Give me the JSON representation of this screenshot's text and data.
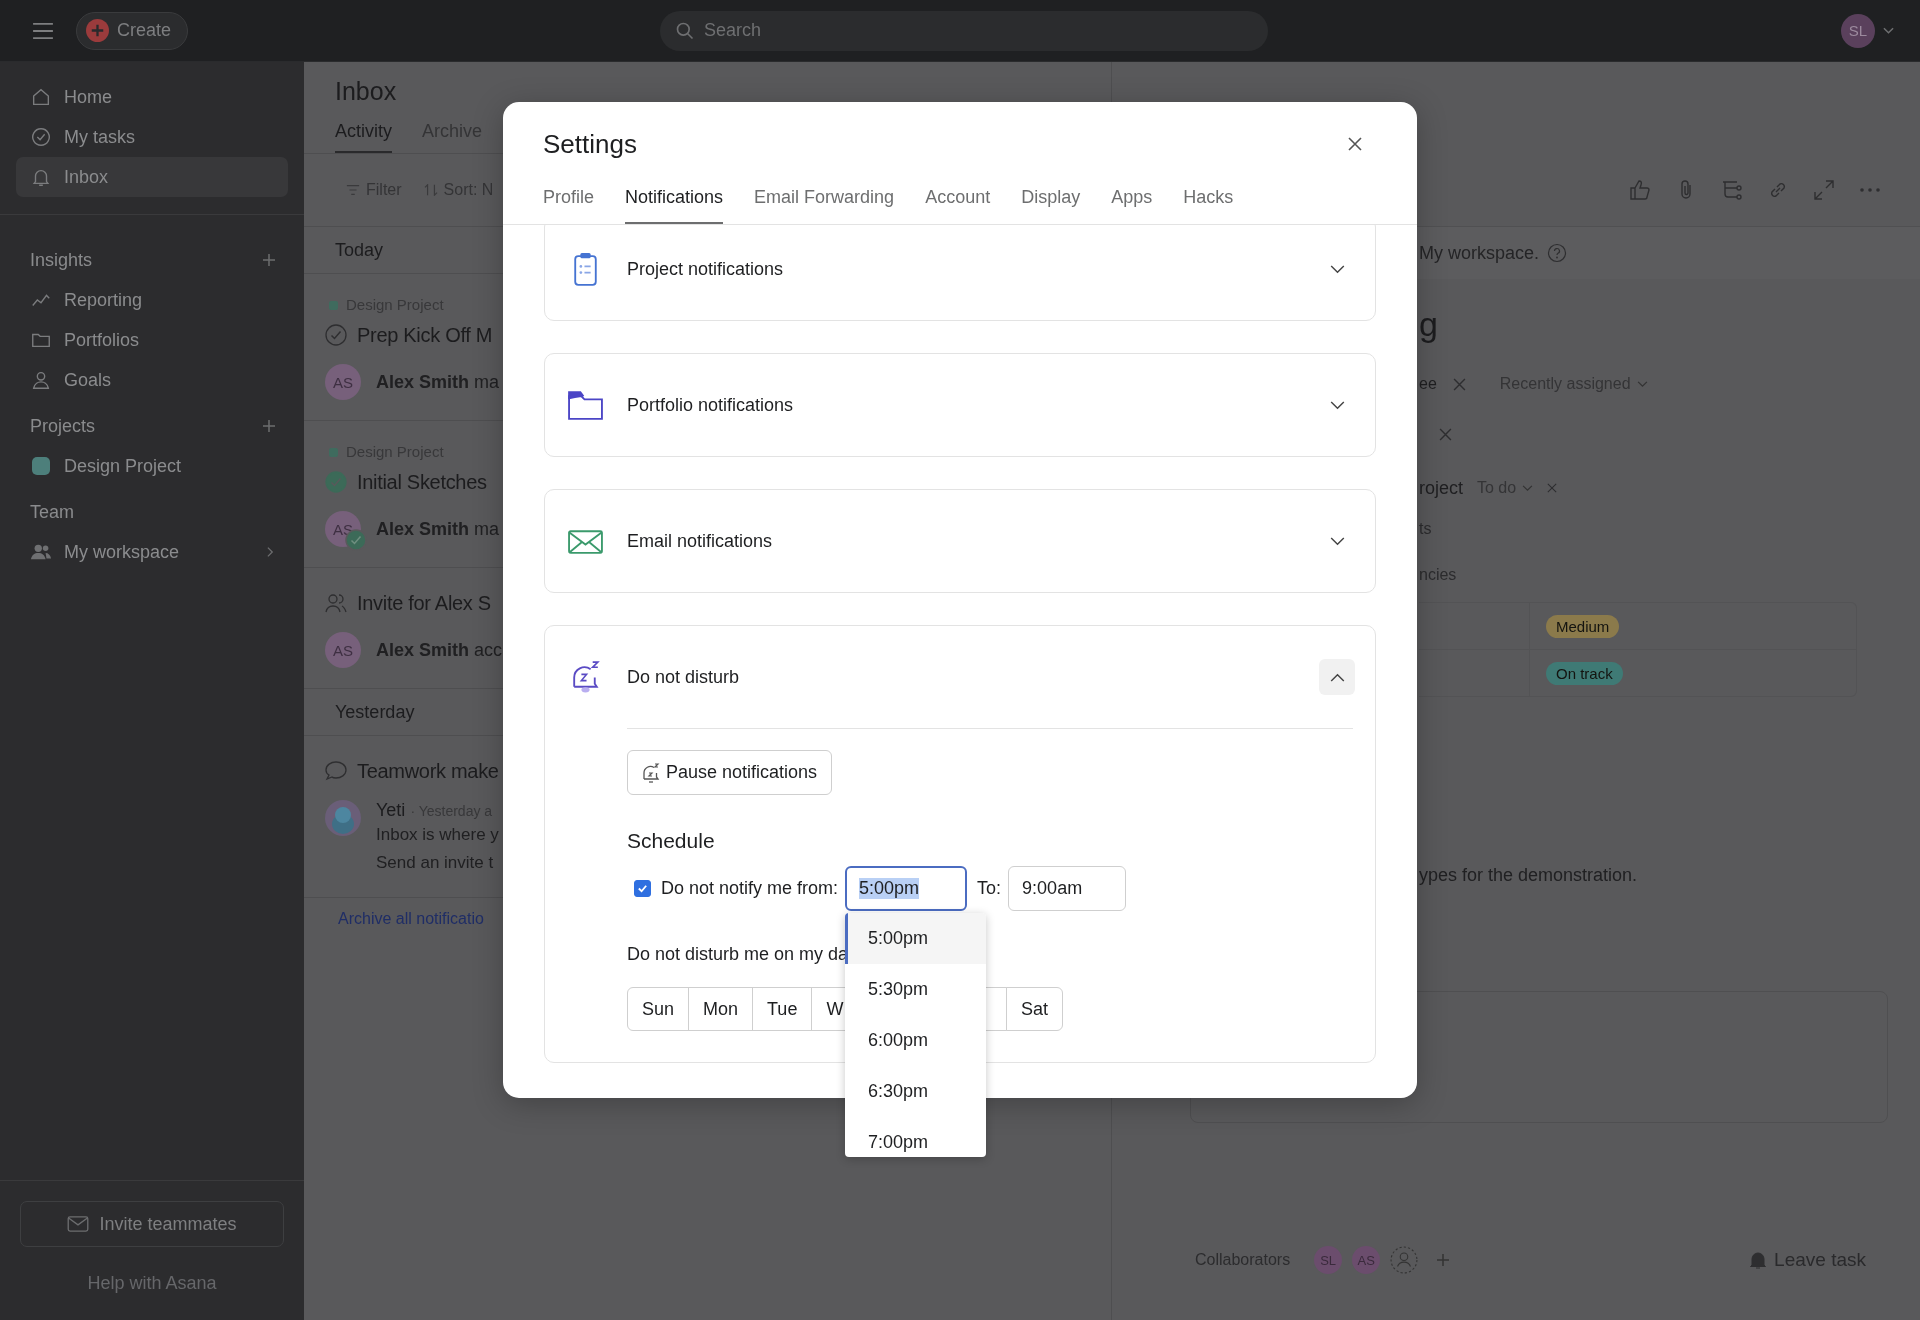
{
  "topbar": {
    "create_button": "Create",
    "search": {
      "placeholder": "Search"
    },
    "user_initials": "SL"
  },
  "sidebar": {
    "nav": [
      {
        "label": "Home",
        "selected": false
      },
      {
        "label": "My tasks",
        "selected": false
      },
      {
        "label": "Inbox",
        "selected": true
      }
    ],
    "insights": {
      "title": "Insights",
      "items": [
        "Reporting",
        "Portfolios",
        "Goals"
      ]
    },
    "projects": {
      "title": "Projects",
      "items": [
        {
          "label": "Design Project",
          "color": "#4d7f7b"
        }
      ]
    },
    "team": {
      "title": "Team",
      "items": [
        "My workspace"
      ]
    },
    "invite_button": "Invite teammates",
    "help_link": "Help with Asana"
  },
  "inbox": {
    "title": "Inbox",
    "tabs": [
      {
        "label": "Activity",
        "selected": true
      },
      {
        "label": "Archive",
        "selected": false
      }
    ],
    "filter_button": "Filter",
    "sort_button": "Sort: N",
    "groups": [
      {
        "heading": "Today",
        "items": [
          {
            "kind": "task",
            "project": "Design Project",
            "title": "Prep Kick Off M",
            "completed": false,
            "avatar": "AS",
            "text": "**Alex Smith** ma"
          },
          {
            "kind": "task",
            "project": "Design Project",
            "title": "Initial Sketches",
            "completed": true,
            "avatar": "AS",
            "text": "**Alex Smith** ma"
          },
          {
            "kind": "invite",
            "title": "Invite for Alex S",
            "avatar": "AS",
            "text": "**Alex Smith** acc"
          }
        ]
      },
      {
        "heading": "Yesterday",
        "items": [
          {
            "kind": "comment",
            "title": "Teamwork make",
            "author": "Yeti",
            "time": "· Yesterday a",
            "lines": [
              "Inbox is where y",
              "Send an invite t"
            ]
          }
        ]
      }
    ],
    "archive_link": "Archive all notificatio"
  },
  "task_pane": {
    "visibility_note": "My workspace.",
    "title": "g",
    "assignee_row": {
      "label": "ee",
      "dropdown": "Recently assigned"
    },
    "project_row": {
      "label": "roject",
      "section": "To do"
    },
    "fragments": [
      "ts",
      "ncies"
    ],
    "custom_fields": [
      {
        "value": "Medium",
        "color": "#8b7a4b"
      },
      {
        "value": "On track",
        "color": "#3f7a75"
      }
    ],
    "description": "ypes for the demonstration.",
    "collaborators": {
      "label": "Collaborators",
      "avatars": [
        "SL",
        "AS"
      ]
    },
    "leave_button": "Leave task"
  },
  "settings_dialog": {
    "title": "Settings",
    "tabs": [
      {
        "label": "Profile",
        "selected": false
      },
      {
        "label": "Notifications",
        "selected": true
      },
      {
        "label": "Email Forwarding",
        "selected": false
      },
      {
        "label": "Account",
        "selected": false
      },
      {
        "label": "Display",
        "selected": false
      },
      {
        "label": "Apps",
        "selected": false
      },
      {
        "label": "Hacks",
        "selected": false
      }
    ],
    "sections": [
      {
        "title": "Project notifications",
        "expanded": false
      },
      {
        "title": "Portfolio notifications",
        "expanded": false
      },
      {
        "title": "Email notifications",
        "expanded": false
      },
      {
        "title": "Do not disturb",
        "expanded": true
      }
    ],
    "do_not_disturb": {
      "pause_button": "Pause notifications",
      "schedule_title": "Schedule",
      "notify_checkbox": {
        "label": "Do not notify me from:",
        "checked": true
      },
      "from": {
        "value": "5:00pm",
        "focused": true
      },
      "to_label": "To:",
      "to": {
        "value": "9:00am",
        "focused": false
      },
      "days_label": "Do not disturb me on my da",
      "days": [
        {
          "label": "Sun",
          "selected": false
        },
        {
          "label": "Mon",
          "selected": false
        },
        {
          "label": "Tue",
          "selected": false
        },
        {
          "label": "W",
          "selected": false
        },
        {
          "label": "Sat",
          "selected": false
        }
      ]
    },
    "time_options": [
      {
        "label": "5:00pm",
        "selected": true
      },
      {
        "label": "5:30pm",
        "selected": false
      },
      {
        "label": "6:00pm",
        "selected": false
      },
      {
        "label": "6:30pm",
        "selected": false
      },
      {
        "label": "7:00pm",
        "selected": false
      }
    ]
  }
}
